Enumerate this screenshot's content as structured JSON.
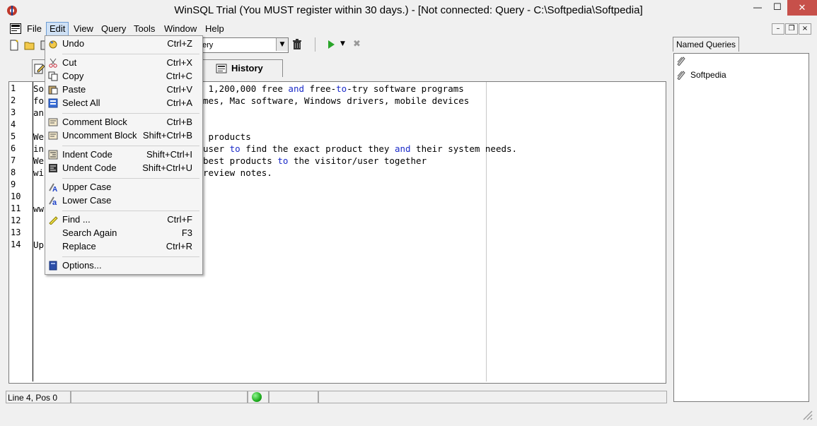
{
  "window": {
    "title": "WinSQL Trial (You MUST register within 30 days.) - [Not connected: Query - C:\\Softpedia\\Softpedia]",
    "minimize_glyph": "—",
    "maximize_glyph": "☐",
    "close_glyph": "✕"
  },
  "menubar": {
    "items": [
      "File",
      "Edit",
      "View",
      "Query",
      "Tools",
      "Window",
      "Help"
    ]
  },
  "mdi_buttons": [
    "–",
    "❐",
    "×"
  ],
  "toolbar": {
    "combo_value": "ery"
  },
  "tabs": {
    "history_label": "History"
  },
  "editor": {
    "line_numbers": [
      "1",
      "2",
      "3",
      "4",
      "5",
      "6",
      "7",
      "8",
      "9",
      "10",
      "11",
      "12",
      "13",
      "14"
    ],
    "lines": [
      {
        "pre": "So",
        "rest": [
          [
            "t",
            " 1,200,000 free "
          ],
          [
            "k",
            "and"
          ],
          [
            "t",
            " free-"
          ],
          [
            "k",
            "to"
          ],
          [
            "t",
            "-try software programs"
          ]
        ]
      },
      {
        "pre": "fo",
        "rest": [
          [
            "t",
            "mes, Mac software, Windows drivers, mobile devices"
          ]
        ]
      },
      {
        "pre": "an",
        "rest": []
      },
      {
        "pre": "",
        "rest": []
      },
      {
        "pre": "We",
        "rest": [
          [
            "t",
            " products"
          ]
        ]
      },
      {
        "pre": "in",
        "rest": [
          [
            "t",
            "user "
          ],
          [
            "k",
            "to"
          ],
          [
            "t",
            " find the exact product they "
          ],
          [
            "k",
            "and"
          ],
          [
            "t",
            " their system needs."
          ]
        ]
      },
      {
        "pre": "We",
        "rest": [
          [
            "t",
            "best products "
          ],
          [
            "k",
            "to"
          ],
          [
            "t",
            " the visitor/user together"
          ]
        ]
      },
      {
        "pre": "wi",
        "rest": [
          [
            "t",
            "review notes."
          ]
        ]
      },
      {
        "pre": "",
        "rest": []
      },
      {
        "pre": "",
        "rest": []
      },
      {
        "pre": "ww",
        "rest": []
      },
      {
        "pre": "",
        "rest": []
      },
      {
        "pre": "",
        "rest": []
      },
      {
        "pre": "Up",
        "rest": []
      }
    ]
  },
  "status": {
    "position": "Line 4, Pos 0",
    "connection_color": "#1fae1f"
  },
  "named_queries": {
    "tab_label": "Named Queries",
    "items": [
      "Softpedia"
    ]
  },
  "edit_menu": {
    "items": [
      {
        "label": "Undo",
        "shortcut": "Ctrl+Z",
        "icon": "undo-icon"
      },
      {
        "label": "Cut",
        "shortcut": "Ctrl+X",
        "icon": "scissors-icon"
      },
      {
        "label": "Copy",
        "shortcut": "Ctrl+C",
        "icon": "copy-icon"
      },
      {
        "label": "Paste",
        "shortcut": "Ctrl+V",
        "icon": "paste-icon"
      },
      {
        "label": "Select All",
        "shortcut": "Ctrl+A",
        "icon": "select-all-icon"
      },
      {
        "label": "Comment Block",
        "shortcut": "Ctrl+B",
        "icon": "comment-block-icon"
      },
      {
        "label": "Uncomment Block",
        "shortcut": "Shift+Ctrl+B",
        "icon": "uncomment-block-icon"
      },
      {
        "label": "Indent Code",
        "shortcut": "Shift+Ctrl+I",
        "icon": "indent-icon"
      },
      {
        "label": "Undent Code",
        "shortcut": "Shift+Ctrl+U",
        "icon": "undent-icon"
      },
      {
        "label": "Upper Case",
        "shortcut": "",
        "icon": "upper-case-icon"
      },
      {
        "label": "Lower Case",
        "shortcut": "",
        "icon": "lower-case-icon"
      },
      {
        "label": "Find ...",
        "shortcut": "Ctrl+F",
        "icon": "find-icon"
      },
      {
        "label": "Search Again",
        "shortcut": "F3",
        "icon": ""
      },
      {
        "label": "Replace",
        "shortcut": "Ctrl+R",
        "icon": ""
      },
      {
        "label": "Options...",
        "shortcut": "",
        "icon": "options-icon"
      }
    ]
  }
}
